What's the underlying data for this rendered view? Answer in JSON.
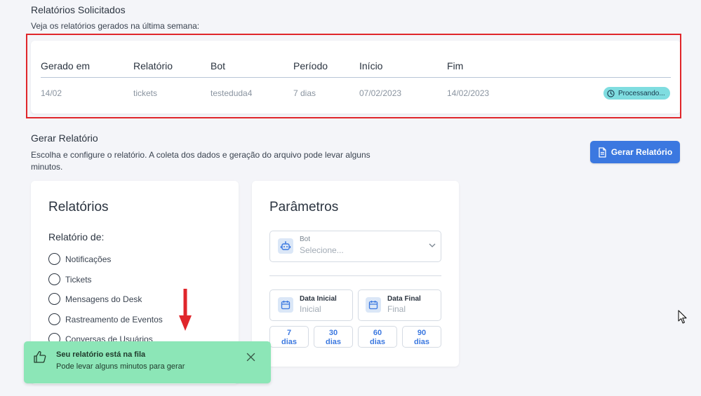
{
  "requested": {
    "title": "Relatórios Solicitados",
    "subtitle": "Veja os relatórios gerados na última semana:",
    "columns": [
      "Gerado em",
      "Relatório",
      "Bot",
      "Período",
      "Início",
      "Fim"
    ],
    "row": {
      "generated_at": "14/02",
      "report": "tickets",
      "bot": "testeduda4",
      "period": "7 dias",
      "start": "07/02/2023",
      "end": "14/02/2023",
      "status": "Processando..."
    }
  },
  "generate": {
    "title": "Gerar Relatório",
    "subtitle_line1": "Escolha e configure o relatório. A coleta dos dados e geração do arquivo pode levar alguns",
    "subtitle_line2": "minutos.",
    "button_label": "Gerar Relatório"
  },
  "reports_card": {
    "title": "Relatórios",
    "label": "Relatório de:",
    "options": [
      "Notificações",
      "Tickets",
      "Mensagens do Desk",
      "Rastreamento de Eventos",
      "Conversas de Usuários"
    ]
  },
  "params_card": {
    "title": "Parâmetros",
    "bot_label": "Bot",
    "bot_placeholder": "Selecione...",
    "start_label": "Data Inicial",
    "start_placeholder": "Inicial",
    "end_label": "Data Final",
    "end_placeholder": "Final",
    "quick_ranges": [
      {
        "num": "7",
        "unit": "dias"
      },
      {
        "num": "30",
        "unit": "dias"
      },
      {
        "num": "60",
        "unit": "dias"
      },
      {
        "num": "90",
        "unit": "dias"
      }
    ]
  },
  "toast": {
    "title": "Seu relatório está na fila",
    "message": "Pode levar alguns minutos para gerar"
  },
  "colors": {
    "accent": "#3b78e0",
    "status_badge": "#7fdde0",
    "toast": "#8ce6b7",
    "highlight_frame": "#e0262b",
    "arrow": "#e0262b"
  }
}
